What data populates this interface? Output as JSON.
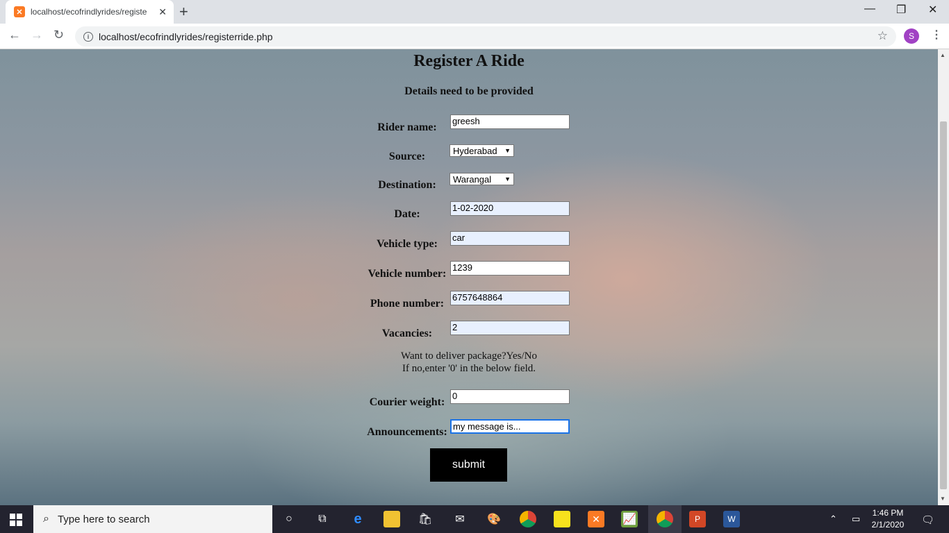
{
  "browser": {
    "tab_title": "localhost/ecofrindlyrides/registe",
    "url": "localhost/ecofrindlyrides/registerride.php",
    "profile_initial": "S"
  },
  "page": {
    "title": "Register A Ride",
    "subtitle": "Details need to be provided",
    "fields": {
      "rider_name": {
        "label": "Rider name:",
        "value": "greesh"
      },
      "source": {
        "label": "Source:",
        "value": "Hyderabad"
      },
      "destination": {
        "label": "Destination:",
        "value": "Warangal"
      },
      "date": {
        "label": "Date:",
        "value": "1-02-2020"
      },
      "vehicle_type": {
        "label": "Vehicle type:",
        "value": "car"
      },
      "vehicle_number": {
        "label": "Vehicle number:",
        "value": "1239"
      },
      "phone_number": {
        "label": "Phone number:",
        "value": "6757648864"
      },
      "vacancies": {
        "label": "Vacancies:",
        "value": "2"
      },
      "courier_weight": {
        "label": "Courier weight:",
        "value": "0"
      },
      "announcements": {
        "label": "Announcements:",
        "value": "my message is..."
      }
    },
    "package_note_line1": "Want to deliver package?Yes/No",
    "package_note_line2": "If no,enter '0' in the below field.",
    "submit_label": "submit"
  },
  "taskbar": {
    "search_placeholder": "Type here to search",
    "time": "1:46 PM",
    "date": "2/1/2020"
  },
  "colors": {
    "submit_bg": "#000000",
    "taskbar_bg": "#23232f",
    "profile_bg": "#a142c4"
  }
}
